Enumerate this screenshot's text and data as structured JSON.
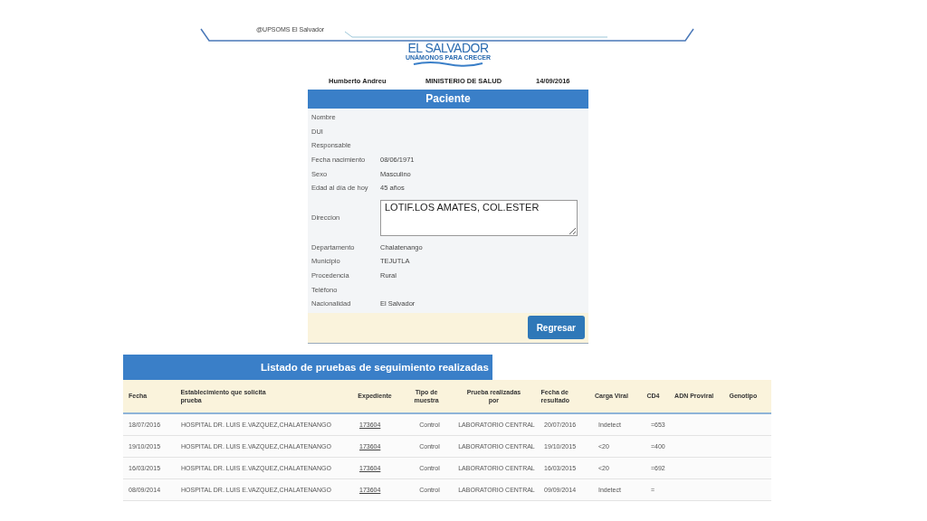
{
  "top_bar": {
    "text": "@UPSOMS El Salvador"
  },
  "logo": {
    "title": "EL SALVADOR",
    "slogan": "UNÁMONOS PARA CRECER"
  },
  "header": {
    "user": "Humberto Andreu",
    "institution": "MINISTERIO DE SALUD",
    "date": "14/09/2016"
  },
  "patient": {
    "title": "Paciente",
    "fields": [
      {
        "label": "Nombre"
      },
      {
        "label": "DUI"
      },
      {
        "label": "Responsable"
      },
      {
        "label": "Fecha nacimiento",
        "value": "08/06/1971"
      },
      {
        "label": "Sexo",
        "value": "Masculino"
      },
      {
        "label": "Edad al día de hoy",
        "value": "45 años"
      },
      {
        "label": "Direccion",
        "kind": "textarea",
        "value": "LOTIF.LOS AMATES, COL.ESTER"
      },
      {
        "label": "Departamento",
        "value": "Chalatenango"
      },
      {
        "label": "Municipio",
        "value": "TEJUTLA"
      },
      {
        "label": "Procedencia",
        "value": "Rural"
      },
      {
        "label": "Teléfono"
      },
      {
        "label": "Nacionalidad",
        "value": "El Salvador"
      }
    ],
    "button": "Regresar"
  },
  "table": {
    "title": "Listado de pruebas de seguimiento realizadas",
    "columns": [
      "Fecha",
      "Establecimiento que solicita prueba",
      "Expediente",
      "Tipo de muestra",
      "Prueba realizadas por",
      "Fecha de resultado",
      "Carga Viral",
      "CD4",
      "ADN Proviral",
      "Genotipo"
    ],
    "rows": [
      [
        "18/07/2016",
        "HOSPITAL DR. LUIS E.VAZQUEZ,CHALATENANGO",
        "173604",
        "Control",
        "LABORATORIO CENTRAL",
        "20/07/2016",
        "Indetect",
        "=653"
      ],
      [
        "19/10/2015",
        "HOSPITAL DR. LUIS E.VAZQUEZ,CHALATENANGO",
        "173604",
        "Control",
        "LABORATORIO CENTRAL",
        "19/10/2015",
        "<20",
        "=400"
      ],
      [
        "16/03/2015",
        "HOSPITAL DR. LUIS E.VAZQUEZ,CHALATENANGO",
        "173604",
        "Control",
        "LABORATORIO CENTRAL",
        "16/03/2015",
        "<20",
        "=692"
      ],
      [
        "08/09/2014",
        "HOSPITAL DR. LUIS E.VAZQUEZ,CHALATENANGO",
        "173604",
        "Control",
        "LABORATORIO CENTRAL",
        "09/09/2014",
        "Indetect",
        "="
      ]
    ]
  }
}
